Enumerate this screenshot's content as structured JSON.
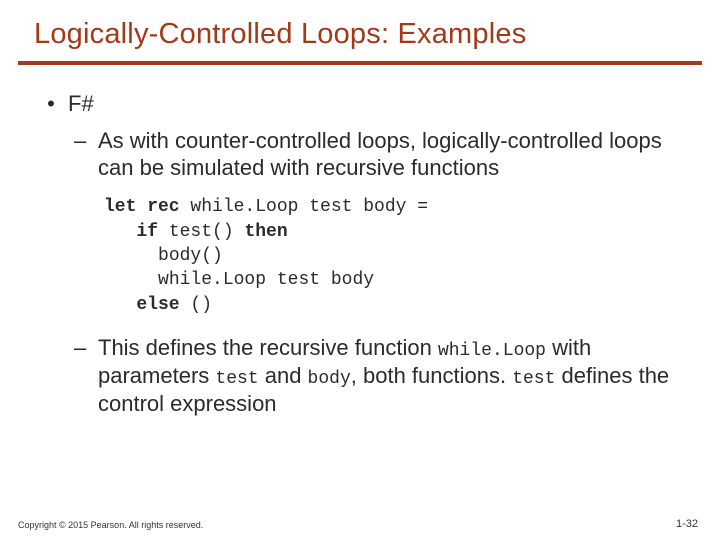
{
  "title": "Logically-Controlled Loops: Examples",
  "topic": "F#",
  "sub1": "As with counter-controlled loops, logically-controlled loops can be simulated with recursive functions",
  "code": {
    "l1a": "let rec",
    "l1b": " while.Loop test body =",
    "l2a": "if",
    "l2b": " test() ",
    "l2c": "then",
    "l3": "body()",
    "l4": "while.Loop test body",
    "l5a": "else",
    "l5b": " ()"
  },
  "sub2": {
    "t1": "This defines the recursive function ",
    "c1": "while.Loop",
    "t2": " with parameters ",
    "c2": "test",
    "t3": " and ",
    "c3": "body",
    "t4": ", both functions. ",
    "c4": "test",
    "t5": " defines the control expression"
  },
  "copyright": "Copyright © 2015 Pearson. All rights reserved.",
  "pagenum": "1-32"
}
